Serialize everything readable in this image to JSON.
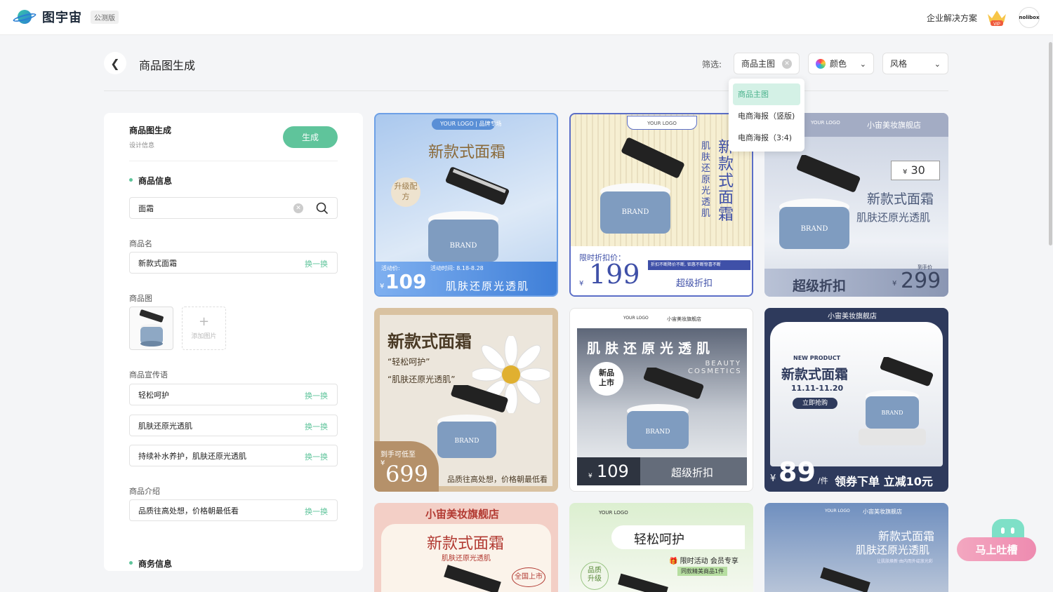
{
  "app": {
    "name": "图宇宙",
    "badge": "公测版",
    "enterprise_link": "企业解决方案",
    "vip_label": "VIP",
    "avatar_text": "nolibox"
  },
  "page": {
    "title": "商品图生成",
    "filter_label": "筛选:"
  },
  "filters": {
    "type": "商品主图",
    "color": "颜色",
    "style": "风格",
    "type_options": [
      {
        "label": "商品主图",
        "selected": true
      },
      {
        "label": "电商海报（竖版)",
        "selected": false
      },
      {
        "label": "电商海报（3:4)",
        "selected": false
      }
    ]
  },
  "panel": {
    "title": "商品图生成",
    "subtitle": "设计信息",
    "generate_label": "生成",
    "section_product": "商品信息",
    "search_value": "面霜",
    "name_label": "商品名",
    "name_value": "新款式面霜",
    "image_label": "商品图",
    "add_image_label": "添加图片",
    "slogan_label": "商品宣传语",
    "slogans": [
      "轻松呵护",
      "肌肤还原光透肌",
      "持续补水养护，肌肤还原光透肌"
    ],
    "intro_label": "商品介绍",
    "intro_value": "品质往高处想，价格朝最低看",
    "swap_label": "换一换",
    "section_business": "商务信息"
  },
  "cards": [
    {
      "logo": "YOUR LOGO",
      "tag": "品牌专场",
      "title": "新款式面霜",
      "badge": "升级配方",
      "price_label": "活动价:",
      "date": "活动时间: 8.18-8.28",
      "currency": "¥",
      "price": "109",
      "slogan": "肌肤还原光透肌",
      "brand": "BRAND"
    },
    {
      "logo": "YOUR LOGO",
      "vtitle": "新款式面霜",
      "vsub": "肌肤还原光透肌",
      "price_label": "限时折扣价：",
      "currency": "¥",
      "price": "199",
      "note": "折扣不断降价不断, 钜惠不断惊喜不断",
      "discount": "超级折扣",
      "brand": "BRAND"
    },
    {
      "logo": "YOUR LOGO",
      "store": "小宙美妆旗舰店",
      "coupon_tag": "优惠券",
      "coupon_cur": "¥",
      "coupon": "30",
      "title": "新款式面霜",
      "sub": "肌肤还原光透肌",
      "discount": "超级折扣",
      "price_label": "到手价",
      "currency": "¥",
      "price": "299",
      "brand": "BRAND"
    },
    {
      "title": "新款式面霜",
      "q1": "“轻松呵护”",
      "q2": "“肌肤还原光透肌”",
      "price_label": "到手可低至",
      "currency": "¥",
      "price": "699",
      "slogan": "品质往高处想，价格朝最低看",
      "brand": "BRAND"
    },
    {
      "logo": "YOUR LOGO",
      "store": "小宙美妆旗舰店",
      "title": "肌肤还原光透肌",
      "en": "BEAUTY COSMETICS",
      "badge": "新品上市",
      "currency": "¥",
      "price": "109",
      "discount": "超级折扣",
      "brand": "BRAND"
    },
    {
      "store": "小宙美妆旗舰店",
      "np": "NEW PRODUCT",
      "title": "新款式面霜",
      "date": "11.11-11.20",
      "buy": "立即抢购",
      "currency": "¥",
      "price": "89",
      "unit": "/件",
      "promo": "领券下单 立减10元",
      "brand": "BRAND"
    },
    {
      "store": "小宙美妆旗舰店",
      "title": "新款式面霜",
      "sub": "肌肤还原光透肌",
      "stamp": "全国上市"
    },
    {
      "logo": "YOUR LOGO",
      "title": "轻松呵护",
      "act": "限时活动 会员专享",
      "gift": "同款精美商品1件",
      "badge": "品质升级"
    },
    {
      "logo": "YOUR LOGO",
      "store": "小宙美妆旗舰店",
      "title": "新款式面霜",
      "sub": "肌肤还原光透肌",
      "small": "让肌肤焕新·由内而外绽放光彩"
    }
  ],
  "chat": {
    "label": "马上吐槽"
  },
  "colors": {
    "accent": "#5fc49b",
    "accent_light": "#d4f1e6"
  }
}
